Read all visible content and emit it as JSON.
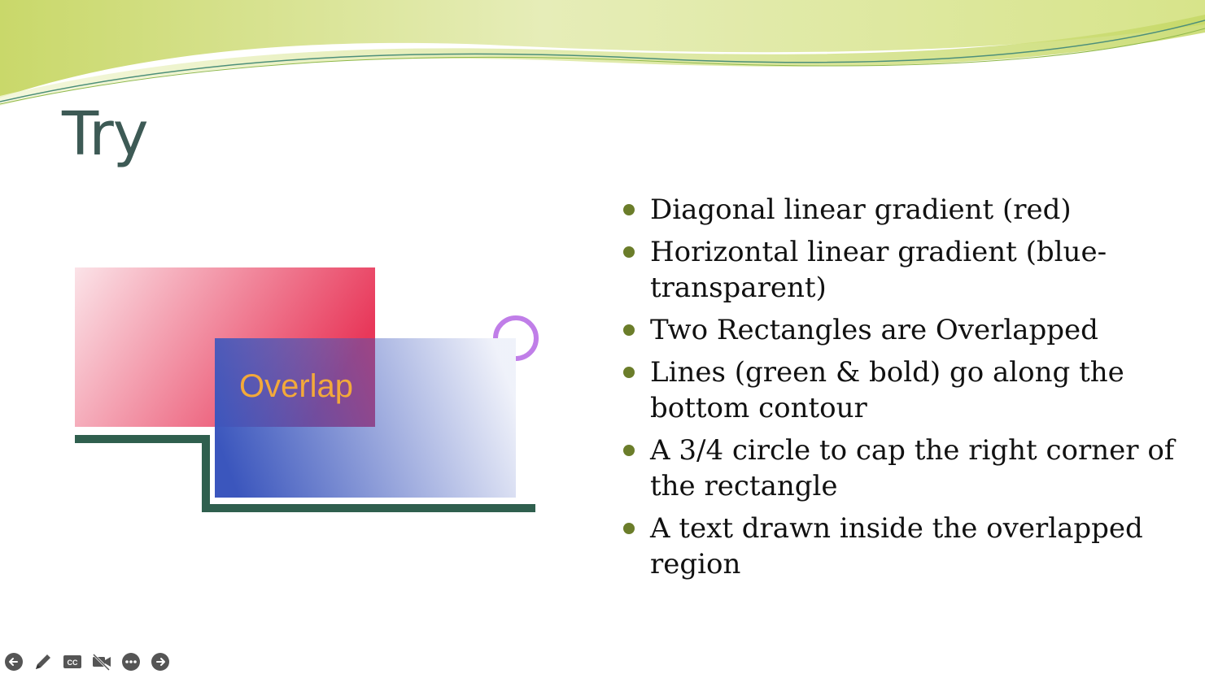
{
  "slide": {
    "title": "Try",
    "bullets": [
      "Diagonal linear gradient (red)",
      "Horizontal linear gradient (blue-transparent)",
      "Two Rectangles are Overlapped",
      "Lines (green & bold) go along the bottom contour",
      "A 3/4 circle to cap the right corner of the rectangle",
      "A text drawn inside the overlapped region"
    ]
  },
  "figure": {
    "overlap_text": "Overlap",
    "colors": {
      "red_gradient": "#e8385a",
      "blue_gradient": "#3b56bd",
      "contour_line": "#2f5f4e",
      "circle_cap": "#c07ee8",
      "overlap_text": "#f3a93a"
    }
  },
  "toolbar": {
    "icons": [
      "back-arrow-icon",
      "pen-icon",
      "closed-captions-icon",
      "video-off-icon",
      "more-icon",
      "forward-arrow-icon"
    ]
  },
  "theme": {
    "title_color": "#3d5a55",
    "bullet_color": "#6b7d2a"
  }
}
